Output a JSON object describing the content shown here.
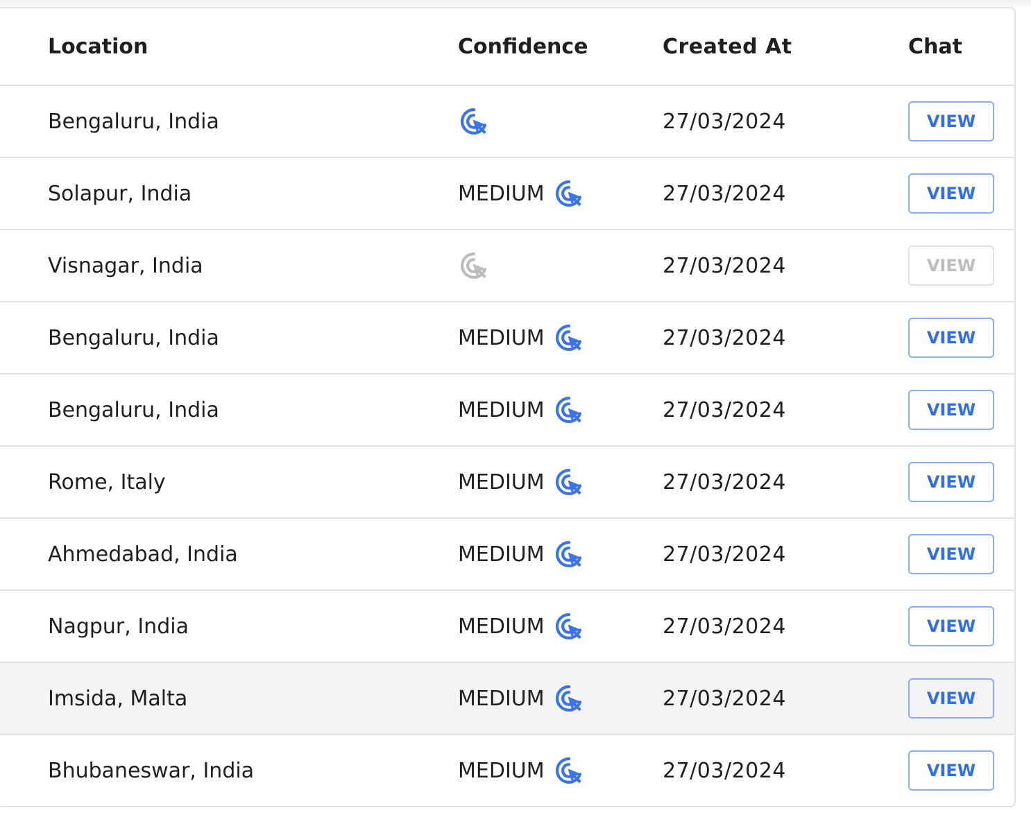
{
  "table": {
    "columns": [
      "Location",
      "Confidence",
      "Created At",
      "Chat"
    ],
    "rows": [
      {
        "location": "Bengaluru, India",
        "confidence": "",
        "icon": "target-cursor-icon",
        "icon_color": "#3b73e8",
        "created_at": "27/03/2024",
        "chat": "VIEW",
        "disabled": false,
        "highlighted": false
      },
      {
        "location": "Solapur, India",
        "confidence": "MEDIUM",
        "icon": "target-cursor-icon",
        "icon_color": "#3b73e8",
        "created_at": "27/03/2024",
        "chat": "VIEW",
        "disabled": false,
        "highlighted": false
      },
      {
        "location": "Visnagar, India",
        "confidence": "",
        "icon": "target-cursor-icon",
        "icon_color": "#bdbdbd",
        "created_at": "27/03/2024",
        "chat": "VIEW",
        "disabled": true,
        "highlighted": false
      },
      {
        "location": "Bengaluru, India",
        "confidence": "MEDIUM",
        "icon": "target-cursor-icon",
        "icon_color": "#3b73e8",
        "created_at": "27/03/2024",
        "chat": "VIEW",
        "disabled": false,
        "highlighted": false
      },
      {
        "location": "Bengaluru, India",
        "confidence": "MEDIUM",
        "icon": "target-cursor-icon",
        "icon_color": "#3b73e8",
        "created_at": "27/03/2024",
        "chat": "VIEW",
        "disabled": false,
        "highlighted": false
      },
      {
        "location": "Rome, Italy",
        "confidence": "MEDIUM",
        "icon": "target-cursor-icon",
        "icon_color": "#3b73e8",
        "created_at": "27/03/2024",
        "chat": "VIEW",
        "disabled": false,
        "highlighted": false
      },
      {
        "location": "Ahmedabad, India",
        "confidence": "MEDIUM",
        "icon": "target-cursor-icon",
        "icon_color": "#3b73e8",
        "created_at": "27/03/2024",
        "chat": "VIEW",
        "disabled": false,
        "highlighted": false
      },
      {
        "location": "Nagpur, India",
        "confidence": "MEDIUM",
        "icon": "target-cursor-icon",
        "icon_color": "#3b73e8",
        "created_at": "27/03/2024",
        "chat": "VIEW",
        "disabled": false,
        "highlighted": false
      },
      {
        "location": "Imsida, Malta",
        "confidence": "MEDIUM",
        "icon": "target-cursor-icon",
        "icon_color": "#3b73e8",
        "created_at": "27/03/2024",
        "chat": "VIEW",
        "disabled": false,
        "highlighted": true
      },
      {
        "location": "Bhubaneswar, India",
        "confidence": "MEDIUM",
        "icon": "target-cursor-icon",
        "icon_color": "#3b73e8",
        "created_at": "27/03/2024",
        "chat": "VIEW",
        "disabled": false,
        "highlighted": false
      }
    ]
  }
}
